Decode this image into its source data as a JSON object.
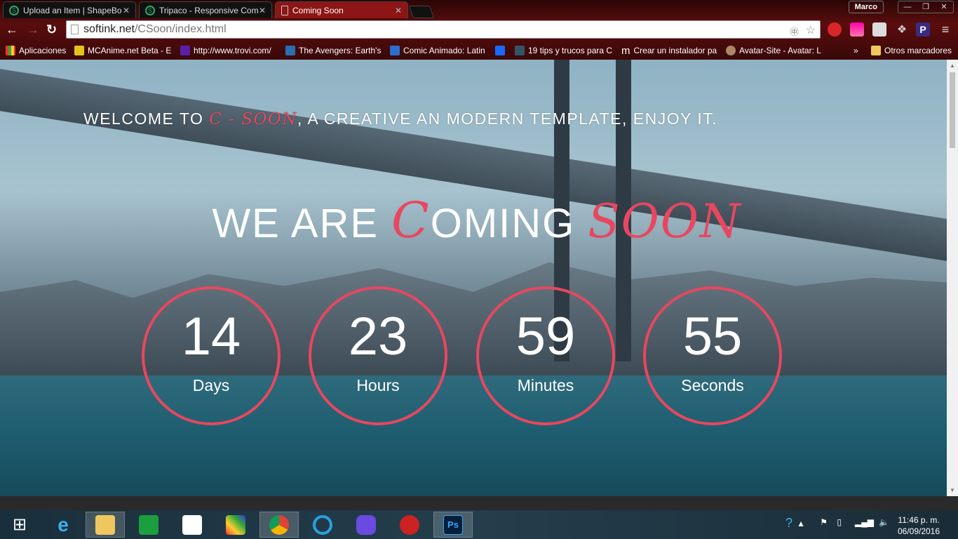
{
  "browser": {
    "tabs": [
      {
        "title": "Upload an Item | ShapeBo"
      },
      {
        "title": "Tripaco - Responsive Com"
      },
      {
        "title": "Coming Soon",
        "active": true
      }
    ],
    "user": "Marco",
    "url_host": "softink.net",
    "url_path": "/CSoon/index.html",
    "bookmarks": [
      {
        "label": "Aplicaciones",
        "color": "#e0a020"
      },
      {
        "label": "MCAnime.net Beta - E",
        "color": "#e5c21a"
      },
      {
        "label": "http://www.trovi.com/",
        "color": "#5a1fa8"
      },
      {
        "label": "The Avengers: Earth's",
        "color": "#2a6fb0"
      },
      {
        "label": "Comic Animado: Latin",
        "color": "#2a6fd0"
      },
      {
        "label": "",
        "color": "#1769ff"
      },
      {
        "label": "19 tips y trucos para C",
        "color": "#356"
      },
      {
        "label": "Crear un instalador pa",
        "color": "#000"
      },
      {
        "label": "Avatar-Site - Avatar: L",
        "color": "#a86"
      }
    ],
    "more_bookmarks": "»",
    "other_bookmarks": "Otros marcadores"
  },
  "page": {
    "welcome_pre": "WELCOME TO ",
    "welcome_brand": "C - SOON",
    "welcome_post": ", A CREATIVE AN MODERN TEMPLATE, ENJOY IT.",
    "title_pre": "WE ARE ",
    "title_c": "C",
    "title_mid": "OMING ",
    "title_soon": "SOON",
    "accent": "#e8475f",
    "countdown": [
      {
        "value": "14",
        "label": "Days"
      },
      {
        "value": "23",
        "label": "Hours"
      },
      {
        "value": "59",
        "label": "Minutes"
      },
      {
        "value": "55",
        "label": "Seconds"
      }
    ]
  },
  "taskbar": {
    "apps": [
      "windows-start",
      "internet-explorer",
      "file-explorer",
      "store",
      "dropbox",
      "app-colorful",
      "chrome",
      "app-blue-circle",
      "app-purple",
      "app-red",
      "photoshop"
    ],
    "time": "11:46 p. m.",
    "date": "06/09/2016"
  }
}
